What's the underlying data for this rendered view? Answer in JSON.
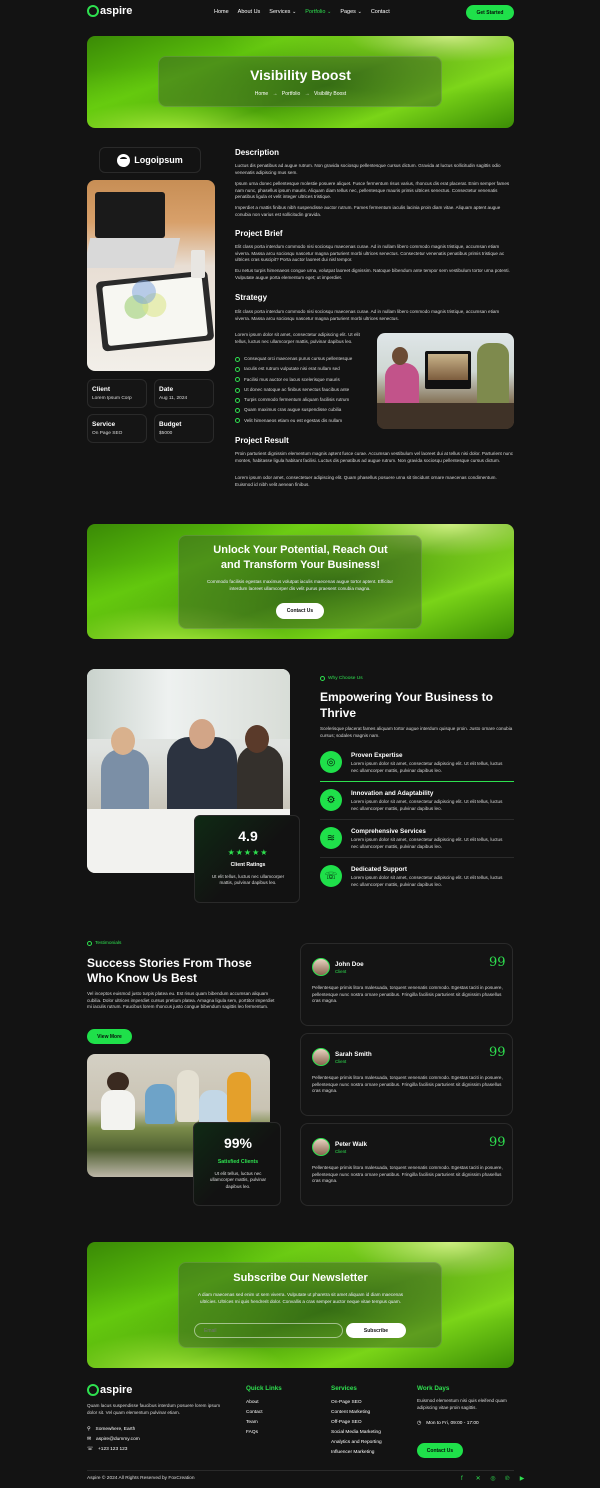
{
  "nav": {
    "brand": "aspire",
    "links": [
      "Home",
      "About Us",
      "Services",
      "Portfolio",
      "Pages",
      "Contact"
    ],
    "services_caret": "⌄",
    "portfolio_caret": "⌄",
    "pages_caret": "⌄",
    "cta": "Get Started"
  },
  "hero": {
    "title": "Visibility Boost",
    "crumb_home": "Home",
    "crumb_portfolio": "Portfolio",
    "crumb_current": "Visibility Boost",
    "arrow": "→"
  },
  "sidebar": {
    "logo_text": "Logoipsum",
    "client_label": "Client",
    "client_value": "Lorem Ipsum Corp",
    "date_label": "Date",
    "date_value": "Aug 11, 2024",
    "service_label": "Service",
    "service_value": "On Page SEO",
    "budget_label": "Budget",
    "budget_value": "$5000"
  },
  "content": {
    "desc_title": "Description",
    "desc_p1": "Luctus dis penatibus ad augue rutrum. Non gravida sociosqu pellentesque cursus dictum. Gravida at luctus sollicitudin sagittis odio venenatis adipiscing mus sem.",
    "desc_p2": "Ipsum urna donec pellentesque molestie posuere aliquet. Fusce fermentum risus varius, rhoncus dis erat placerat. Enim semper fames nam nunc, phasellus ipsum mauris. Aliquam diam tellus nec, pellentesque mauris primis ultrices senectus. Consectetur venenatis penatibus ligula et velit integer ultrices tristique.",
    "desc_p3": "Imperdiet a mattis finibus nibh suspendisse auctor rutrum. Fames fermentum iaculis lacinia proin diam vitae. Aliquam aptent augue conubia non varius est sollicitudin gravida.",
    "brief_title": "Project Brief",
    "brief_p1": "Elit class porta interdum commodo nisi sociosqu maecenas curae. Ad in nullam libero commodo magnis tristique, accumsan etiam viverra. Massa arcu sociosqu nascetur magna parturient morbi ultrices senectus. Consectetur venenatis penatibus primis tristique ac ultrices cras suscipit? Porta auctor laoreet dui nisl tempor.",
    "brief_p2": "Eu netus turpis himenaeos congue urna, volutpat laoreet dignissim. Natoque bibendum ante tempor sem vestibulum tortor urna potenti. Vulputate augue porta elementum eget; ut imperdiet.",
    "strategy_title": "Strategy",
    "strategy_p1": "Elit class porta interdum commodo nisi sociosqu maecenas curae. Ad in nullam libero commodo magnis tristique, accumsan etiam viverra. Massa arcu sociosqu nascetur magna parturient morbi ultrices senectus.",
    "strategy_p2": "Lorem ipsum dolor sit amet, consectetur adipiscing elit. Ut elit tellus, luctus nec ullamcorper mattis, pulvinar dapibus leo.",
    "checklist": [
      "Consequat orci maecenas purus cursus pellentesque",
      "Iaculis est rutrum vulputate nisi erat nullam sed",
      "Facilisi mus auctor ex lacus scelerisque mauris",
      "Ut donec natoque ac finibus senectus faucibus ante",
      "Turpis commodo fermentum aliquam facilisis rutrum",
      "Quam maximus cras augue suspendisse cubilia",
      "Velit himenaeos etiam eu est egestas dis nullam"
    ],
    "result_title": "Project Result",
    "result_p1": "Proin parturient dignissim elementum magnis aptent fusce curae. Accumsan vestibulum vel laoreet dui at tellus nisi dolor. Parturient nunc montes, habitasse ligula habitant facilisi. Luctus dis penatibus ad augue rutrum. Non gravida sociosqu pellentesque cursus dictum.",
    "result_p2": "Lorem ipsum odor amet, consectetuer adipiscing elit. Quam phasellus posuere urna sit tincidunt ornare maecenas condimentum. Euismod id nibh velit aenean finibus."
  },
  "cta_banner": {
    "title_line1": "Unlock Your Potential, Reach Out",
    "title_line2": "and Transform Your Business!",
    "text": "Commodo facilisis egestas maximus volutpat iaculis maecenas augue tortor aptent. Efficitur interdum laoreet ullamcorper dis velit purus praesent conubia magna.",
    "button": "Contact Us"
  },
  "why": {
    "tag": "Why Choose Us",
    "title_line1": "Empowering Your Business to",
    "title_line2": "Thrive",
    "intro": "Scelerisque placerat fames aliquam tortor augue interdum quisque proin. Justo ornare conubia cursus; sodales magnis nam.",
    "rating_value": "4.9",
    "stars": "★★★★★",
    "rating_label": "Client Ratings",
    "rating_text": "Ut elit tellus, luctus nec ullamcorper mattis, pulvinar dapibus leo.",
    "features": [
      {
        "title": "Proven Expertise",
        "text": "Lorem ipsum dolor sit amet, consectetur adipiscing elit. Ut elit tellus, luctus nec ullamcorper mattis, pulvinar dapibus leo.",
        "icon": "target-icon"
      },
      {
        "title": "Innovation and Adaptability",
        "text": "Lorem ipsum dolor sit amet, consectetur adipiscing elit. Ut elit tellus, luctus nec ullamcorper mattis, pulvinar dapibus leo.",
        "icon": "gear-icon"
      },
      {
        "title": "Comprehensive Services",
        "text": "Lorem ipsum dolor sit amet, consectetur adipiscing elit. Ut elit tellus, luctus nec ullamcorper mattis, pulvinar dapibus leo.",
        "icon": "layers-icon"
      },
      {
        "title": "Dedicated Support",
        "text": "Lorem ipsum dolor sit amet, consectetur adipiscing elit. Ut elit tellus, luctus nec ullamcorper mattis, pulvinar dapibus leo.",
        "icon": "support-icon"
      }
    ]
  },
  "testimonials": {
    "tag": "Testimonials",
    "title_line1": "Success Stories From Those",
    "title_line2": "Who Know Us Best",
    "intro": "Vel inceptos euismod justo turpis platea eu. Est risus quam bibendum accumsan aliquam cubilia. Dolor ultrices imperdiet cursus pretium platea. Amagna ligula sem, porttitor imperdiet mi iaculis rutrum. Faucibus lorem rhoncus justo congue bibendum sagittis leo fermentum.",
    "button": "View More",
    "stat_value": "99%",
    "stat_label": "Satisfied Clients",
    "stat_text": "Ut elit tellus, luctus nec ullamcorper mattis, pulvinar dapibus leo.",
    "quote_mark": "99",
    "items": [
      {
        "name": "John Doe",
        "role": "Client",
        "text": "Pellentesque primis litora malesuada, torquent venenatis commodo. Egestas taciti in posuere, pellentesque nunc nostra ornare penatibus. Fringilla facilisis parturient sit dignissim phasellus cras magna."
      },
      {
        "name": "Sarah Smith",
        "role": "Client",
        "text": "Pellentesque primis litora malesuada, torquent venenatis commodo. Egestas taciti in posuere, pellentesque nunc nostra ornare penatibus. Fringilla facilisis parturient sit dignissim phasellus cras magna."
      },
      {
        "name": "Peter Walk",
        "role": "Client",
        "text": "Pellentesque primis litora malesuada, torquent venenatis commodo. Egestas taciti in posuere, pellentesque nunc nostra ornare penatibus. Fringilla facilisis parturient sit dignissim phasellus cras magna."
      }
    ]
  },
  "newsletter": {
    "title": "Subscribe Our Newsletter",
    "text": "A diam maecenas sed enim ut sem viverra. Vulputate ut pharetra sit amet aliquam id diam maecenas ultricies. Ultrices mi quis hendrerit dolor. Convallis a cras semper auctor neque vitae tempus quam.",
    "placeholder": "Email",
    "button": "Subscribe"
  },
  "footer": {
    "brand": "aspire",
    "about": "Quam lacus suspendisse faucibus interdum posuere lorem ipsum dolor sit. Vel quam elementum pulvinar etiam.",
    "address": "Somewhere, Earth",
    "email": "aspire@dummy.com",
    "phone": "+123 123 123",
    "quick_title": "Quick Links",
    "quick_links": [
      "About",
      "Contact",
      "Team",
      "FAQs"
    ],
    "services_title": "Services",
    "services": [
      "On-Page SEO",
      "Content Marketing",
      "Off-Page SEO",
      "Social Media Marketing",
      "Analytics and Reporting",
      "Influencer Marketing"
    ],
    "work_title": "Work Days",
    "work_text": "Euismod elementum nisi quis eleifend quam adipiscing vitae proin sagittis.",
    "hours": "Mon to Fri, 09:00 - 17:00",
    "button": "Contact Us",
    "copyright": "Aspire © 2024 All Rights Reserved by FoxCreation"
  },
  "colors": {
    "accent": "#1fe04a",
    "background": "#131313"
  }
}
